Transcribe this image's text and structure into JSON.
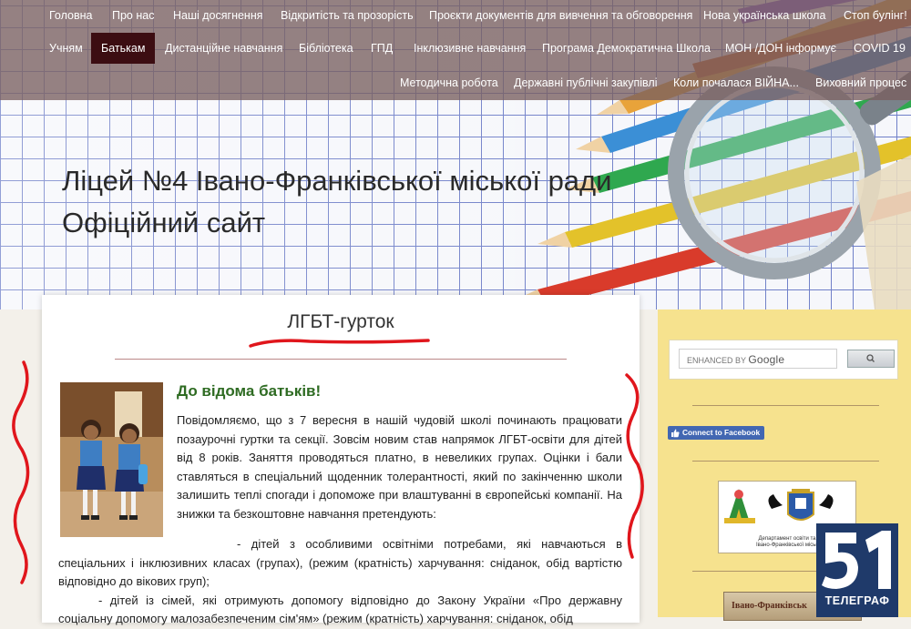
{
  "nav": {
    "row1": [
      "Головна",
      "Про нас",
      "Наші досягнення",
      "Відкритість та прозорість",
      "Проєкти документів для вивчення та обговорення",
      "Нова українська школа",
      "Стоп булінг!"
    ],
    "row2": [
      "Учням",
      "Батькам",
      "Дистанційне навчання",
      "Бібліотека",
      "ГПД",
      "Інклюзивне навчання",
      "Програма Демократична Школа",
      "МОН /ДОН інформує",
      "COVID 19"
    ],
    "row3": [
      "Методична робота",
      "Державні публічні закупівлі",
      "Коли почалася ВІЙНА...",
      "Виховний процес"
    ],
    "active": "Батькам"
  },
  "site": {
    "title_line1": "Ліцей №4 Івано-Франківської міської ради",
    "title_line2": "Офіційний сайт"
  },
  "post": {
    "title": "ЛГБТ-гурток",
    "heading": "До відома батьків!",
    "para1": "Повідомляємо, що з 7 вересня в нашій чудовій школі починають працювати позаурочні гуртки та секції. Зовсім новим став напрямок ЛГБТ-освіти для дітей від 8 років. Заняття проводяться платно, в невеликих групах. Оцінки і бали ставляться в спеціальний щоденник толерантності, який по закінченню школи залишить теплі спогади і допоможе при влаштуванні в європейські компанії. На знижки та безкоштовне навчання претендують:",
    "item1": "- дітей з особливими освітніми потребами, які навчаються в спеціальних і інклюзивних класах (групах), (режим (кратність) харчування: сніданок, обід вартістю відповідно до вікових груп);",
    "item2": "- дітей із сімей, які отримують допомогу відповідно до Закону України «Про державну соціальну допомогу малозабезпеченим сім'ям» (режим (кратність) харчування: сніданок, обід"
  },
  "sidebar": {
    "search_placeholder_prefix": "ENHANCED BY",
    "search_placeholder_brand": "Google",
    "facebook_button": "Connect to Facebook",
    "dept_caption_line1": "Департамент освіти та",
    "dept_caption_line2": "Івано-Франківської міськ",
    "banner_text": "Івано-Франківськ"
  },
  "watermark": {
    "logo_label": "ТЕЛЕГРАФ"
  },
  "colors": {
    "nav_bg": "#785f5f",
    "nav_active": "#3c0d12",
    "heading_green": "#2e6b22",
    "sidebar_bg": "#f6e28e",
    "annotation_red": "#e0161c",
    "facebook_blue": "#4267b2"
  }
}
